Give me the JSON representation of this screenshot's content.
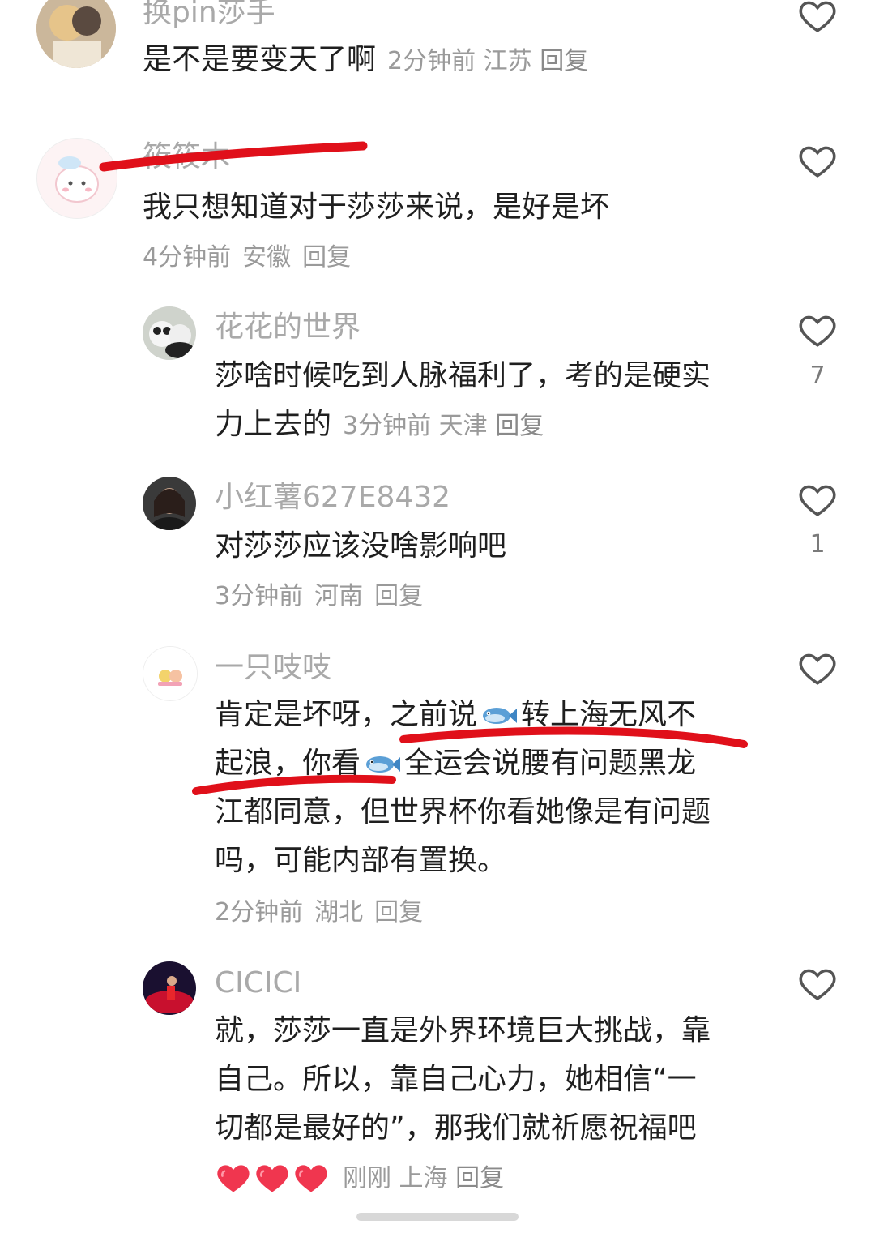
{
  "comments": [
    {
      "username": "换pin莎手",
      "text": "是不是要变天了啊",
      "time": "2分钟前",
      "location": "江苏",
      "reply": "回复",
      "likes": ""
    },
    {
      "username": "筱筱木",
      "text": "我只想知道对于莎莎来说，是好是坏",
      "time": "4分钟前",
      "location": "安徽",
      "reply": "回复",
      "likes": ""
    },
    {
      "username": "花花的世界",
      "text_line1": "莎啥时候吃到人脉福利了，考的是硬实",
      "text_line2": "力上去的",
      "time": "3分钟前",
      "location": "天津",
      "reply": "回复",
      "likes": "7"
    },
    {
      "username": "小红薯627E8432",
      "text": "对莎莎应该没啥影响吧",
      "time": "3分钟前",
      "location": "河南",
      "reply": "回复",
      "likes": "1"
    },
    {
      "username": "一只吱吱",
      "text_l1a": "肯定是坏呀，之前说",
      "text_l1b": "转上海无风不",
      "text_l2a": "起浪，你看",
      "text_l2b": "全运会说腰有问题黑龙",
      "text_l3": "江都同意，但世界杯你看她像是有问题",
      "text_l4": "吗，可能内部有置换。",
      "time": "2分钟前",
      "location": "湖北",
      "reply": "回复",
      "likes": ""
    },
    {
      "username": "CICICI",
      "text_line1": "就，莎莎一直是外界环境巨大挑战，靠",
      "text_line2": "自己。所以，靠自己心力，她相信“一",
      "text_line3": "切都是最好的”，那我们就祈愿祝福吧",
      "time": "刚刚",
      "location": "上海",
      "reply": "回复",
      "likes": ""
    }
  ],
  "colors": {
    "username": "#a9a9a9",
    "meta": "#9a9a9a",
    "text": "#1f1f1f",
    "annotation": "#e0101a",
    "heart_emoji": "#f0364f"
  },
  "icons": {
    "like": "heart-outline-icon",
    "fish": "fish-emoji-icon",
    "heart": "red-heart-emoji-icon"
  }
}
